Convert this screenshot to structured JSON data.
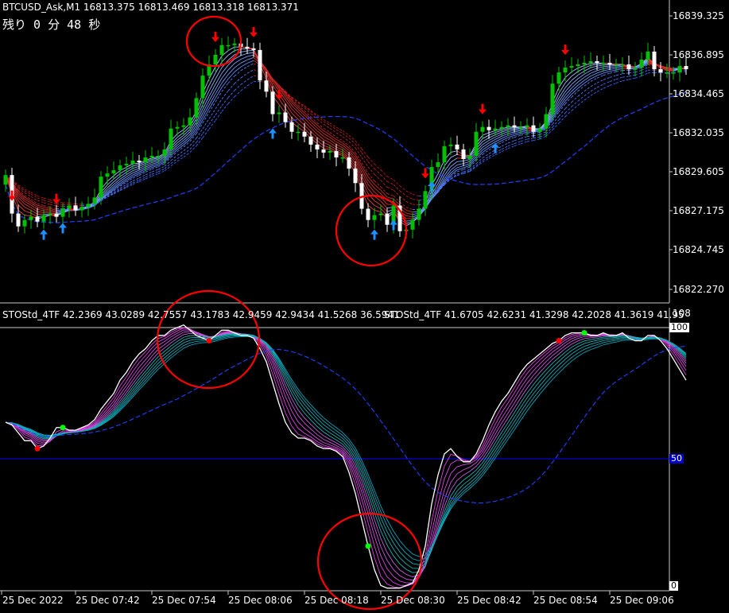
{
  "header": {
    "symbol_line": "BTCUSD_Ask,M1  16813.375 16813.469 16813.318 16813.371",
    "countdown": "残り 0 分 48 秒"
  },
  "indicator": {
    "label_1": "STOStd_4TF 42.2369 43.0289 42.7557 43.1783 42.9459 42.9434 41.5268 36.5941",
    "label_2": "STOStd_4TF 41.6705 42.6231 41.3298 42.2028 41.3619 41.95",
    "scale_top": "108",
    "level_100": "100",
    "level_50": "50",
    "level_0": "0"
  },
  "colors": {
    "background": "#000000",
    "bull_candle": "#00c000",
    "bear_candle": "#ffffff",
    "sell_arrow": "#ff0000",
    "buy_arrow": "#1e90ff",
    "circle": "#ff0000",
    "level_50_line": "#0000ff"
  },
  "price_axis": [
    "16839.325",
    "16836.895",
    "16834.465",
    "16832.035",
    "16829.605",
    "16827.175",
    "16824.745",
    "16822.270"
  ],
  "time_axis": [
    "25 Dec 2022",
    "25 Dec 07:42",
    "25 Dec 07:54",
    "25 Dec 08:06",
    "25 Dec 08:18",
    "25 Dec 08:30",
    "25 Dec 08:42",
    "25 Dec 08:54",
    "25 Dec 09:06"
  ],
  "chart_data": [
    {
      "type": "candlestick",
      "symbol": "BTCUSD_Ask",
      "timeframe": "M1",
      "ylim": [
        16821.6,
        16840.2
      ],
      "sell_arrows": 8,
      "buy_arrows": 7,
      "close": [
        16829.4,
        16827.0,
        16826.2,
        16826.6,
        16826.8,
        16826.5,
        16826.9,
        16827.0,
        16826.8,
        16827.3,
        16827.5,
        16827.2,
        16827.4,
        16827.6,
        16828.0,
        16829.3,
        16829.5,
        16829.7,
        16830.0,
        16830.1,
        16830.3,
        16830.2,
        16830.5,
        16830.6,
        16830.6,
        16831.0,
        16832.3,
        16832.4,
        16832.5,
        16833.0,
        16834.2,
        16835.6,
        16836.3,
        16836.9,
        16837.5,
        16837.5,
        16837.6,
        16837.4,
        16837.3,
        16837.2,
        16835.3,
        16834.6,
        16833.2,
        16833.3,
        16832.7,
        16832.1,
        16832.1,
        16831.8,
        16831.3,
        16831.0,
        16830.8,
        16830.9,
        16830.5,
        16830.5,
        16829.8,
        16828.9,
        16827.3,
        16826.6,
        16826.9,
        16827.0,
        16826.3,
        16827.5,
        16825.9,
        16826.0,
        16826.6,
        16827.3,
        16828.4,
        16829.9,
        16830.2,
        16831.2,
        16831.3,
        16831.0,
        16830.4,
        16830.6,
        16832.1,
        16832.4,
        16832.2,
        16832.3,
        16832.4,
        16832.5,
        16832.4,
        16832.4,
        16832.5,
        16832.1,
        16832.3,
        16833.2,
        16835.1,
        16835.8,
        16836.1,
        16836.2,
        16836.3,
        16836.4,
        16836.5,
        16836.4,
        16836.4,
        16836.3,
        16836.3,
        16836.3,
        16836.0,
        16836.1,
        16836.6,
        16837.1,
        16836.0,
        16835.8,
        16835.8,
        16835.8,
        16836.2,
        16836.0
      ]
    },
    {
      "type": "line",
      "name": "STOStd_4TF",
      "ylim": [
        0,
        108
      ],
      "levels": [
        100,
        50
      ],
      "white_line": [
        64,
        63,
        60,
        57,
        57,
        54,
        55,
        58,
        62,
        62,
        61,
        61,
        62,
        63,
        65,
        69,
        72,
        75,
        80,
        83,
        87,
        90,
        92,
        95,
        97,
        97,
        99,
        100,
        101,
        99,
        97,
        96,
        95,
        97,
        99,
        99,
        98,
        97,
        97,
        96,
        92,
        87,
        79,
        71,
        64,
        60,
        58,
        58,
        57,
        55,
        54,
        54,
        53,
        51,
        45,
        37,
        27,
        17,
        8,
        2,
        1,
        1,
        1,
        2,
        3,
        8,
        17,
        33,
        44,
        52,
        54,
        51,
        49,
        49,
        52,
        57,
        63,
        68,
        72,
        75,
        79,
        83,
        86,
        88,
        90,
        92,
        94,
        95,
        97,
        98,
        98,
        98,
        97,
        97,
        98,
        97,
        97,
        98,
        96,
        95,
        95,
        97,
        97,
        95,
        92,
        88,
        84,
        80
      ]
    }
  ]
}
